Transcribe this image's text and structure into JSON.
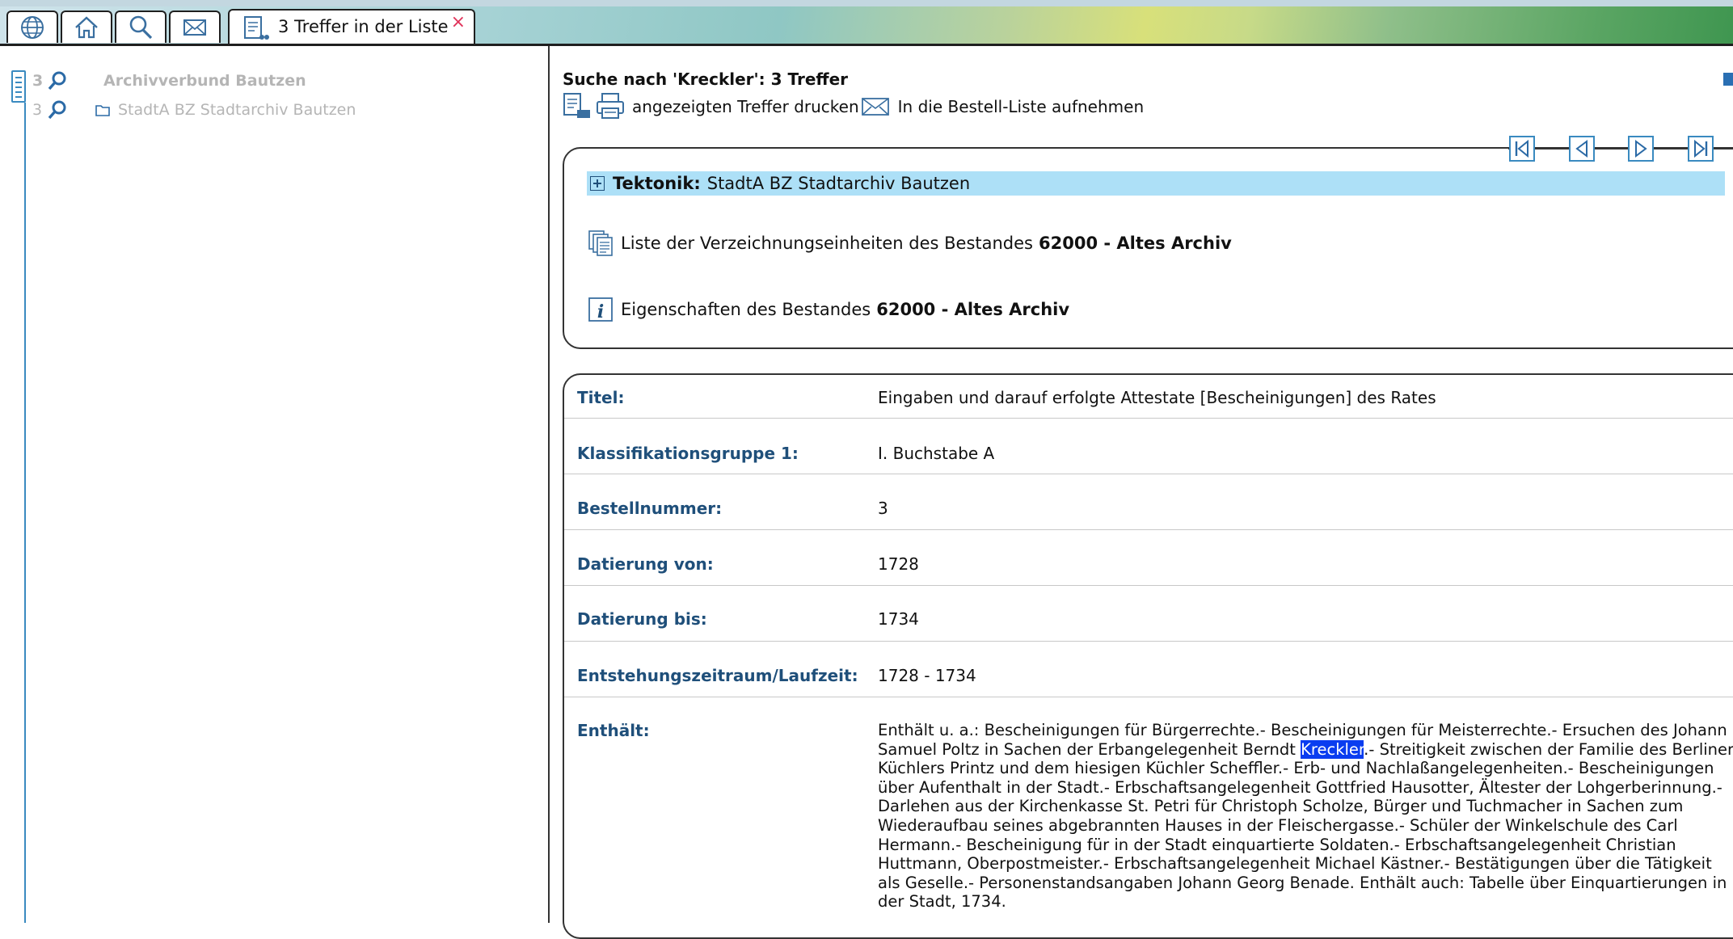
{
  "tabs": {
    "icons": [
      "globe-icon",
      "home-icon",
      "search-icon",
      "mail-icon"
    ],
    "active_label": "3 Treffer in der Liste",
    "close_glyph": "×"
  },
  "tree": {
    "rows": [
      {
        "count": "3",
        "name": "Archivverbund Bautzen"
      },
      {
        "count": "3",
        "name": "StadtA BZ Stadtarchiv Bautzen"
      }
    ]
  },
  "main": {
    "heading": "Suche nach 'Kreckler': 3 Treffer",
    "print_label": "angezeigten Treffer drucken",
    "order_label": "In die Bestell-Liste aufnehmen",
    "tektonik_label": "Tektonik:",
    "tektonik_value": "StadtA BZ Stadtarchiv Bautzen",
    "list_text": "Liste der Verzeichnungseinheiten des Bestandes",
    "list_bold": "62000 - Altes Archiv",
    "props_text": "Eigenschaften des Bestandes",
    "props_bold": "62000 - Altes Archiv"
  },
  "fields": [
    {
      "key": "Titel:",
      "value": "Eingaben und darauf erfolgte Attestate [Bescheinigungen] des Rates"
    },
    {
      "key": "Klassifikationsgruppe 1:",
      "value": "I. Buchstabe A"
    },
    {
      "key": "Bestellnummer:",
      "value": "3"
    },
    {
      "key": "Datierung von:",
      "value": "1728"
    },
    {
      "key": "Datierung bis:",
      "value": "1734"
    },
    {
      "key": "Entstehungszeitraum/Laufzeit:",
      "value": "1728 - 1734"
    }
  ],
  "contains": {
    "key": "Enthält:",
    "text_before": "Enthält u. a.: Bescheinigungen für Bürgerrechte.- Bescheinigungen für Meisterrechte.- Ersuchen des Johann Samuel Poltz in Sachen der Erbangelegenheit Berndt ",
    "highlight": "Kreckler",
    "text_after": ".- Streitigkeit zwischen der Familie des Berliner Küchlers Printz und dem hiesigen Küchler Scheffler.- Erb- und Nachlaßangelegenheiten.- Bescheinigungen über Aufenthalt in der Stadt.- Erbschaftsangelegenheit Gottfried Hausotter, Ältester der Lohgerberinnung.- Darlehen aus der Kirchenkasse St. Petri für Christoph Scholze, Bürger und Tuchmacher in Sachen zum Wiederaufbau seines abgebrannten Hauses in der Fleischergasse.- Schüler der Winkelschule des Carl Hermann.- Bescheinigung für in der Stadt einquartierte Soldaten.- Erbschaftsangelegenheit Christian Huttmann, Oberpostmeister.- Erbschaftsangelegenheit Michael Kästner.- Bestätigungen über die Tätigkeit als Geselle.- Personenstandsangaben Johann Georg Benade. Enthält auch: Tabelle über Einquartierungen in der Stadt, 1734."
  },
  "colors": {
    "accent": "#3a8ac0",
    "key_text": "#1f4f7a",
    "highlight": "#0a3df0",
    "tektonik_bg": "#ade0f7"
  }
}
